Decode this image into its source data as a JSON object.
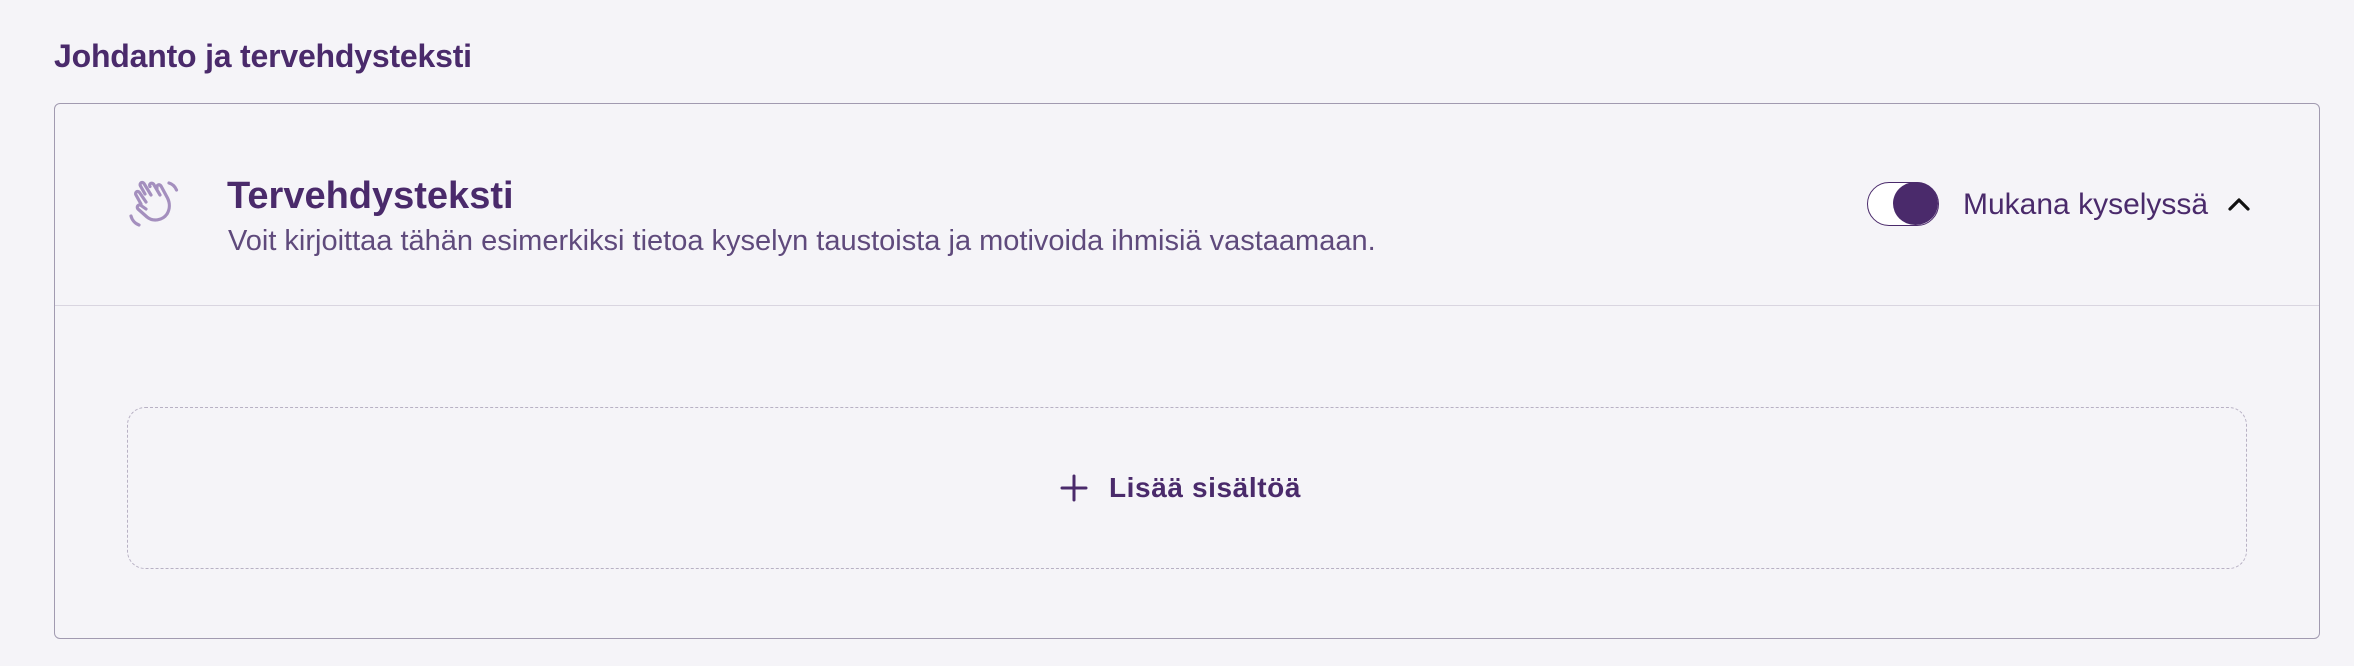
{
  "section": {
    "heading": "Johdanto ja tervehdysteksti"
  },
  "card": {
    "icon": "waving-hand-icon",
    "title": "Tervehdysteksti",
    "description": "Voit kirjoittaa tähän esimerkiksi tietoa kyselyn taustoista ja motivoida ihmisiä vastaamaan.",
    "toggle": {
      "label": "Mukana kyselyssä",
      "checked": true
    },
    "collapse_icon": "chevron-up-icon"
  },
  "add_content": {
    "icon": "plus-icon",
    "label": "Lisää sisältöä"
  },
  "colors": {
    "primary": "#4a2a6b",
    "icon_muted": "#a48fbe",
    "background": "#f5f4f8",
    "border": "#a19ab0"
  }
}
